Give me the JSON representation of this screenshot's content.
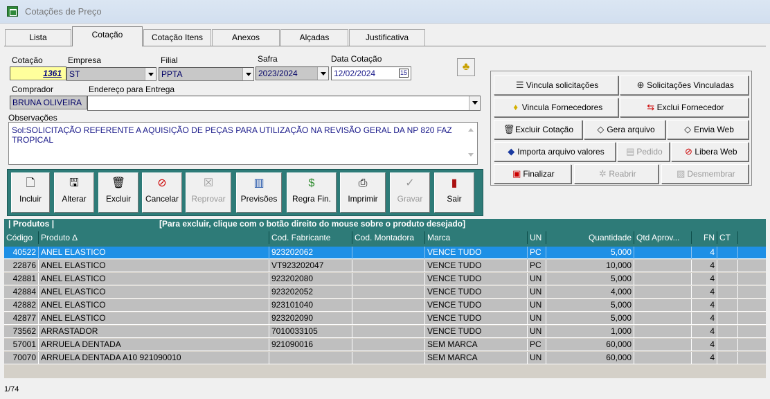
{
  "window": {
    "title": "Cotações de Preço"
  },
  "tabs": [
    "Lista",
    "Cotação",
    "Cotação Itens",
    "Anexos",
    "Alçadas",
    "Justificativa"
  ],
  "form": {
    "cotacao_label": "Cotação",
    "cotacao_value": "1361",
    "empresa_label": "Empresa",
    "empresa_value": "ST",
    "filial_label": "Filial",
    "filial_value": "PPTA",
    "safra_label": "Safra",
    "safra_value": "2023/2024",
    "data_label": "Data Cotação",
    "data_value": "12/02/2024",
    "comprador_label": "Comprador",
    "comprador_value": "BRUNA OLIVEIRA",
    "endereco_label": "Endereço para Entrega",
    "endereco_value": "",
    "obs_label": "Observações",
    "obs_value": "Sol:SOLICITAÇÃO REFERENTE A  AQUISIÇÃO DE PEÇAS PARA UTILIZAÇÃO NA REVISÃO GERAL DA NP 820 FAZ TROPICAL"
  },
  "toolbar": {
    "incluir": "Incluir",
    "alterar": "Alterar",
    "excluir": "Excluir",
    "cancelar": "Cancelar",
    "reprovar": "Reprovar",
    "previsoes": "Previsões",
    "regra": "Regra Fin.",
    "imprimir": "Imprimir",
    "gravar": "Gravar",
    "sair": "Sair"
  },
  "actions": {
    "vincula_solicitacoes": "Vincula solicitações",
    "solicitacoes_vinculadas": "Solicitações Vinculadas",
    "vincula_fornecedores": "Vincula Fornecedores",
    "exclui_fornecedor": "Exclui Fornecedor",
    "excluir_cotacao": "Excluir Cotação",
    "gera_arquivo": "Gera arquivo",
    "envia_web": "Envia Web",
    "importa_arquivo": "Importa arquivo valores",
    "pedido": "Pedido",
    "libera_web": "Libera Web",
    "finalizar": "Finalizar",
    "reabrir": "Reabrir",
    "desmembrar": "Desmembrar"
  },
  "grid": {
    "section_title": "| Produtos |",
    "hint": "[Para excluir, clique com o botão direito do mouse sobre o produto desejado]",
    "columns": [
      "Código",
      "Produto    ∆",
      "Cod. Fabricante",
      "Cod. Montadora",
      "Marca",
      "UN",
      "Quantidade",
      "Qtd Aprov...",
      "FN",
      "CT"
    ],
    "rows": [
      {
        "codigo": "40522",
        "produto": "ANEL ELASTICO",
        "fabricante": "923202062",
        "montadora": "",
        "marca": "VENCE TUDO",
        "un": "PC",
        "qtd": "5,000",
        "aprov": "",
        "fn": "4",
        "ct": ""
      },
      {
        "codigo": "22876",
        "produto": "ANEL ELASTICO",
        "fabricante": "VT923202047",
        "montadora": "",
        "marca": "VENCE TUDO",
        "un": "PC",
        "qtd": "10,000",
        "aprov": "",
        "fn": "4",
        "ct": ""
      },
      {
        "codigo": "42881",
        "produto": "ANEL ELASTICO",
        "fabricante": "923202080",
        "montadora": "",
        "marca": "VENCE TUDO",
        "un": "UN",
        "qtd": "5,000",
        "aprov": "",
        "fn": "4",
        "ct": ""
      },
      {
        "codigo": "42884",
        "produto": "ANEL ELASTICO",
        "fabricante": "923202052",
        "montadora": "",
        "marca": "VENCE TUDO",
        "un": "UN",
        "qtd": "4,000",
        "aprov": "",
        "fn": "4",
        "ct": ""
      },
      {
        "codigo": "42882",
        "produto": "ANEL ELASTICO",
        "fabricante": "923101040",
        "montadora": "",
        "marca": "VENCE TUDO",
        "un": "UN",
        "qtd": "5,000",
        "aprov": "",
        "fn": "4",
        "ct": ""
      },
      {
        "codigo": "42877",
        "produto": "ANEL ELASTICO",
        "fabricante": "923202090",
        "montadora": "",
        "marca": "VENCE TUDO",
        "un": "UN",
        "qtd": "5,000",
        "aprov": "",
        "fn": "4",
        "ct": ""
      },
      {
        "codigo": "73562",
        "produto": "ARRASTADOR",
        "fabricante": "7010033105",
        "montadora": "",
        "marca": "VENCE TUDO",
        "un": "UN",
        "qtd": "1,000",
        "aprov": "",
        "fn": "4",
        "ct": ""
      },
      {
        "codigo": "57001",
        "produto": "ARRUELA DENTADA",
        "fabricante": "921090016",
        "montadora": "",
        "marca": "SEM MARCA",
        "un": "PC",
        "qtd": "60,000",
        "aprov": "",
        "fn": "4",
        "ct": ""
      },
      {
        "codigo": "70070",
        "produto": "ARRUELA DENTADA A10 921090010",
        "fabricante": "",
        "montadora": "",
        "marca": "SEM MARCA",
        "un": "UN",
        "qtd": "60,000",
        "aprov": "",
        "fn": "4",
        "ct": ""
      }
    ]
  },
  "status": {
    "record": "1/74"
  }
}
